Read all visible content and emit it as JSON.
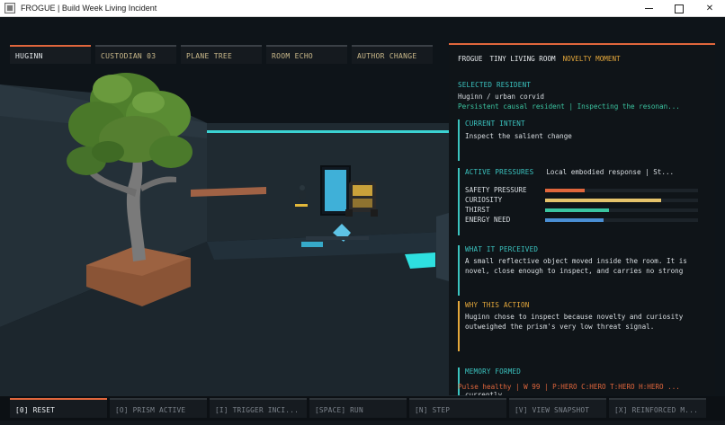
{
  "window": {
    "title": "FROGUE | Build Week Living Incident"
  },
  "top_tabs": [
    {
      "label": "HUGINN",
      "active": true
    },
    {
      "label": "CUSTODIAN 03",
      "active": false
    },
    {
      "label": "PLANE TREE",
      "active": false
    },
    {
      "label": "ROOM ECHO",
      "active": false
    },
    {
      "label": "AUTHOR CHANGE",
      "active": false
    }
  ],
  "panel": {
    "header": {
      "app": "FROGUE",
      "room": "TINY LIVING ROOM",
      "moment": "NOVELTY MOMENT"
    },
    "selected_resident": {
      "label": "SELECTED RESIDENT",
      "name": "Huginn / urban corvid",
      "status": "Persistent causal resident | Inspecting the resonan..."
    },
    "current_intent": {
      "label": "CURRENT INTENT",
      "text": "Inspect the salient change"
    },
    "active_pressures": {
      "label": "ACTIVE PRESSURES",
      "summary": "Local embodied response | St...",
      "bars": [
        {
          "label": "SAFETY PRESSURE",
          "value": 0.26,
          "color": "#e0663c"
        },
        {
          "label": "CURIOSITY",
          "value": 0.76,
          "color": "#e5c36b"
        },
        {
          "label": "THIRST",
          "value": 0.42,
          "color": "#3bc4a0"
        },
        {
          "label": "ENERGY NEED",
          "value": 0.38,
          "color": "#4a8fd4"
        }
      ]
    },
    "what_it_perceived": {
      "label": "WHAT IT PERCEIVED",
      "text": "A small reflective object moved inside the room. It is novel, close enough to inspect, and carries no strong"
    },
    "why_this_action": {
      "label": "WHY THIS ACTION",
      "text": "Huginn chose to inspect because novelty and curiosity outweighed the prism's very low threat signal."
    },
    "memory_formed": {
      "label": "MEMORY FORMED",
      "text": "currently"
    },
    "status_line": "Pulse healthy | W 99 | P:HERO C:HERO T:HERO H:HERO ..."
  },
  "bottom_buttons": [
    {
      "label": "[0] RESET",
      "active": true
    },
    {
      "label": "[O] PRISM ACTIVE",
      "active": false
    },
    {
      "label": "[I] TRIGGER INCI...",
      "active": false
    },
    {
      "label": "[SPACE] RUN",
      "active": false
    },
    {
      "label": "[N] STEP",
      "active": false
    },
    {
      "label": "[V] VIEW SNAPSHOT",
      "active": false
    },
    {
      "label": "[X] REINFORCED M...",
      "active": false
    }
  ],
  "colors": {
    "accent_orange": "#e0663c",
    "accent_cyan": "#3bc4c0",
    "accent_gold": "#e5a83b",
    "panel_bg": "#0f1418"
  }
}
